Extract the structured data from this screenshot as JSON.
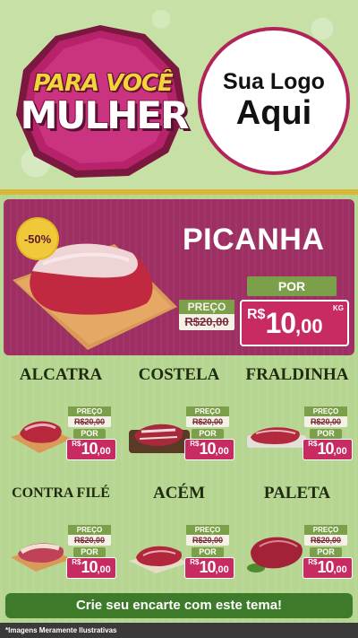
{
  "header": {
    "badge_line1": "PARA VOCÊ",
    "badge_line2": "MULHER",
    "logo_line1": "Sua Logo",
    "logo_line2": "Aqui"
  },
  "hero": {
    "name": "PICANHA",
    "discount": "-50%",
    "preco_label": "PREÇO",
    "old_price": "R$20,00",
    "por_label": "POR",
    "currency": "R$",
    "price_int": "10",
    "price_dec": ",00",
    "unit": "KG"
  },
  "products": [
    {
      "name": "ALCATRA",
      "preco_label": "PREÇO",
      "old_price": "R$20,00",
      "por_label": "POR",
      "currency": "R$",
      "price_int": "10",
      "price_dec": ",00"
    },
    {
      "name": "COSTELA",
      "preco_label": "PREÇO",
      "old_price": "R$20,00",
      "por_label": "POR",
      "currency": "R$",
      "price_int": "10",
      "price_dec": ",00"
    },
    {
      "name": "FRALDINHA",
      "preco_label": "PREÇO",
      "old_price": "R$20,00",
      "por_label": "POR",
      "currency": "R$",
      "price_int": "10",
      "price_dec": ",00"
    },
    {
      "name": "CONTRA FILÉ",
      "preco_label": "PREÇO",
      "old_price": "R$20,00",
      "por_label": "POR",
      "currency": "R$",
      "price_int": "10",
      "price_dec": ",00"
    },
    {
      "name": "ACÉM",
      "preco_label": "PREÇO",
      "old_price": "R$20,00",
      "por_label": "POR",
      "currency": "R$",
      "price_int": "10",
      "price_dec": ",00"
    },
    {
      "name": "PALETA",
      "preco_label": "PREÇO",
      "old_price": "R$20,00",
      "por_label": "POR",
      "currency": "R$",
      "price_int": "10",
      "price_dec": ",00"
    }
  ],
  "cta": {
    "label": "Crie seu encarte com este tema!"
  },
  "footer": {
    "note": "*Imagens Meramente Ilustrativas"
  },
  "colors": {
    "accent": "#c72b62",
    "hero_bg": "#9d2f62",
    "green": "#7ca04a",
    "cta": "#3d7a2a"
  }
}
